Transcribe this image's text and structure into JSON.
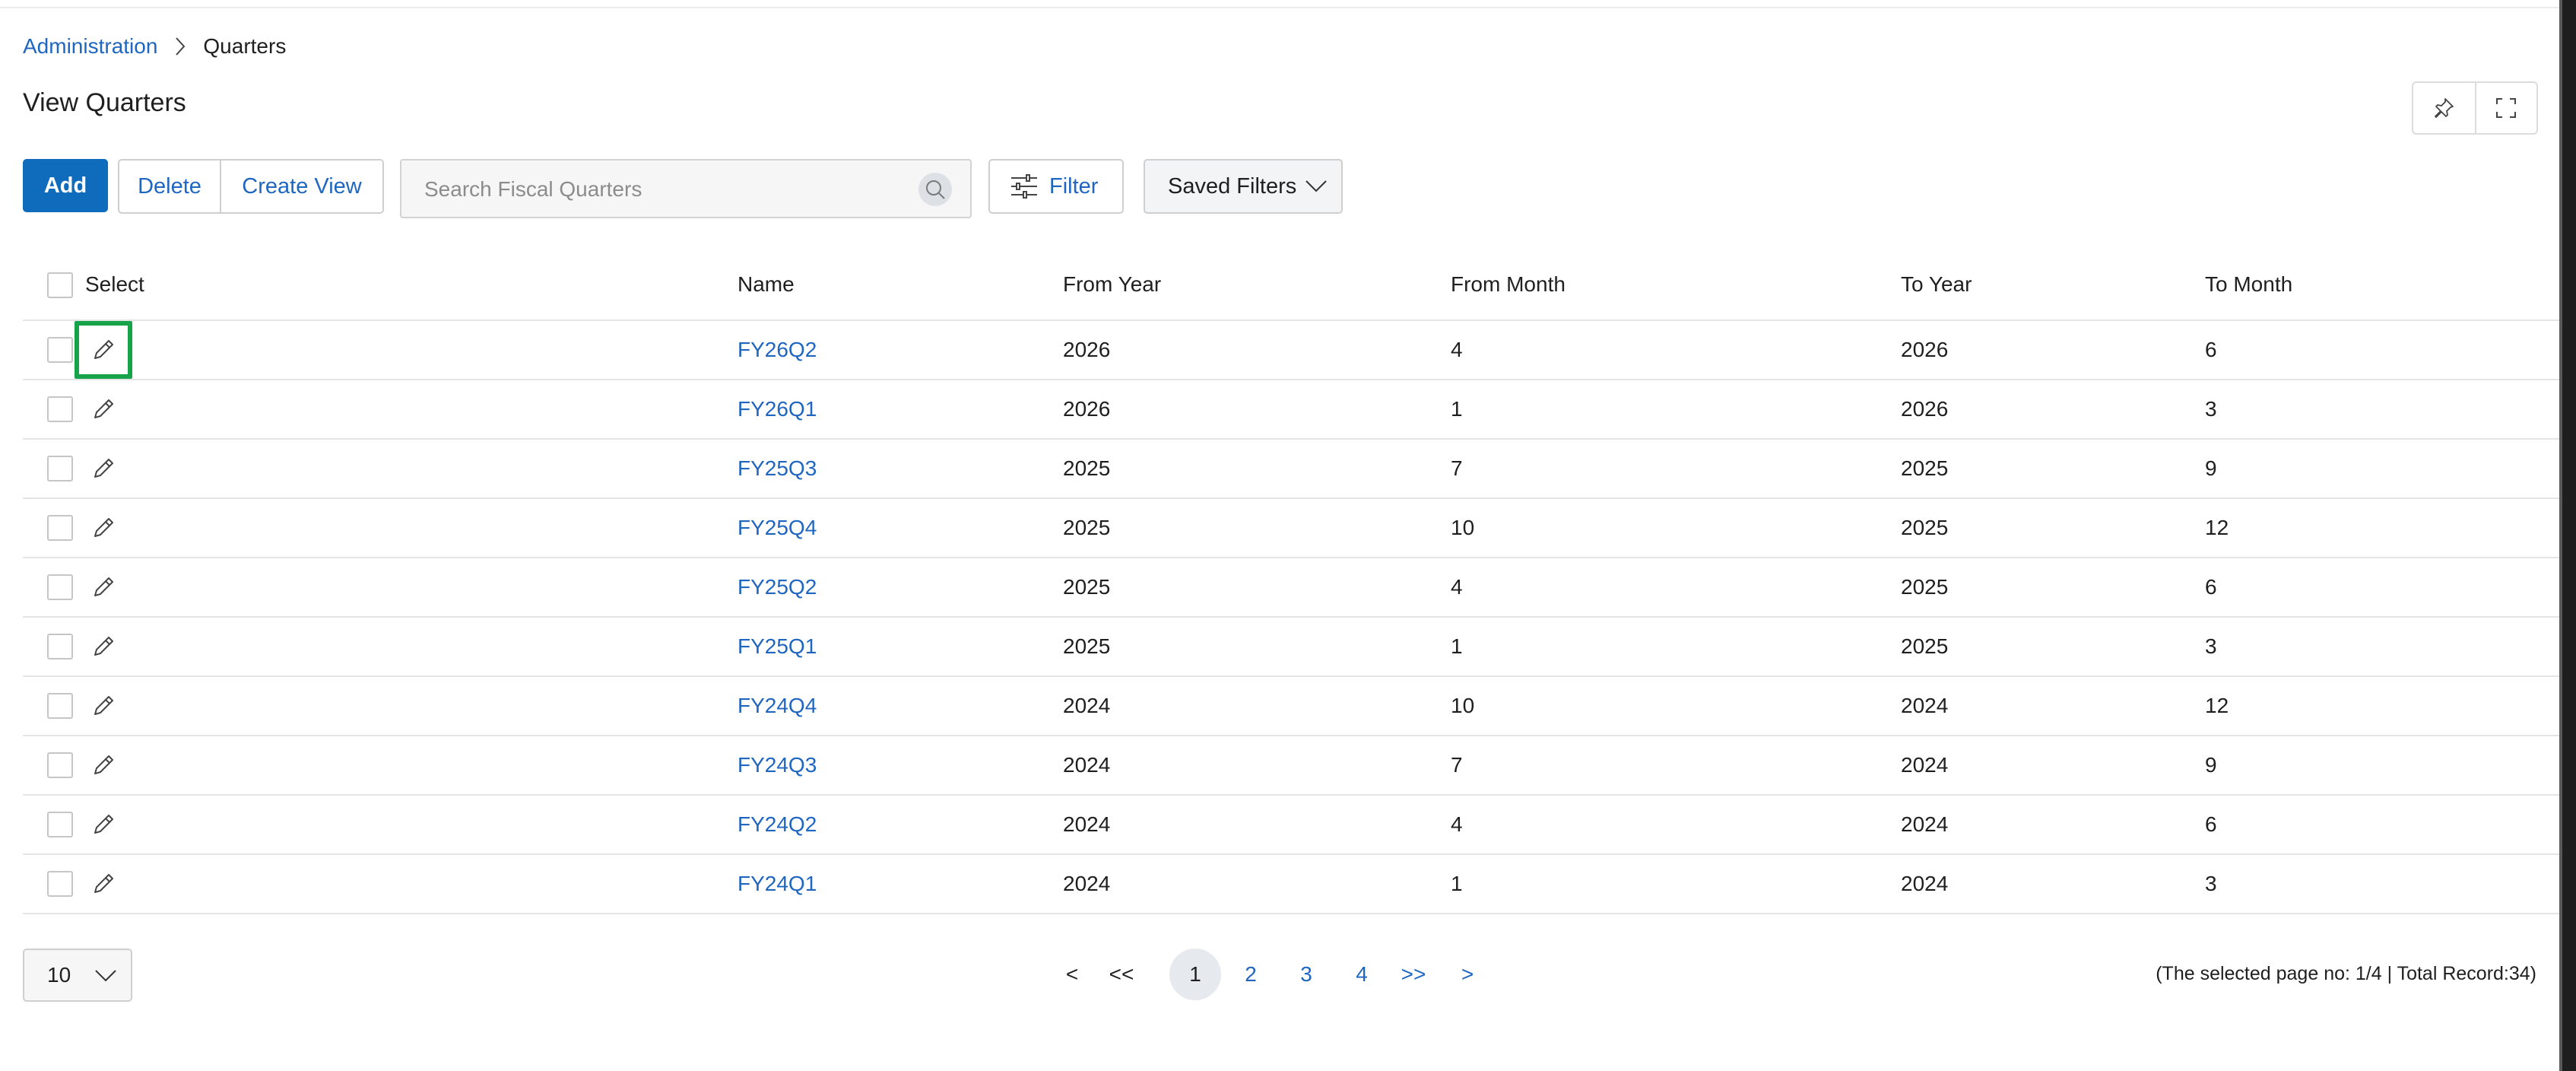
{
  "breadcrumb": {
    "parent": "Administration",
    "current": "Quarters"
  },
  "page": {
    "title": "View Quarters"
  },
  "toolbar": {
    "add_label": "Add",
    "delete_label": "Delete",
    "create_view_label": "Create View",
    "search_placeholder": "Search Fiscal Quarters",
    "search_value": "",
    "filter_label": "Filter",
    "saved_filters_label": "Saved Filters"
  },
  "table": {
    "headers": {
      "select": "Select",
      "name": "Name",
      "from_year": "From Year",
      "from_month": "From Month",
      "to_year": "To Year",
      "to_month": "To Month"
    },
    "rows": [
      {
        "name": "FY26Q2",
        "from_year": "2026",
        "from_month": "4",
        "to_year": "2026",
        "to_month": "6"
      },
      {
        "name": "FY26Q1",
        "from_year": "2026",
        "from_month": "1",
        "to_year": "2026",
        "to_month": "3"
      },
      {
        "name": "FY25Q3",
        "from_year": "2025",
        "from_month": "7",
        "to_year": "2025",
        "to_month": "9"
      },
      {
        "name": "FY25Q4",
        "from_year": "2025",
        "from_month": "10",
        "to_year": "2025",
        "to_month": "12"
      },
      {
        "name": "FY25Q2",
        "from_year": "2025",
        "from_month": "4",
        "to_year": "2025",
        "to_month": "6"
      },
      {
        "name": "FY25Q1",
        "from_year": "2025",
        "from_month": "1",
        "to_year": "2025",
        "to_month": "3"
      },
      {
        "name": "FY24Q4",
        "from_year": "2024",
        "from_month": "10",
        "to_year": "2024",
        "to_month": "12"
      },
      {
        "name": "FY24Q3",
        "from_year": "2024",
        "from_month": "7",
        "to_year": "2024",
        "to_month": "9"
      },
      {
        "name": "FY24Q2",
        "from_year": "2024",
        "from_month": "4",
        "to_year": "2024",
        "to_month": "6"
      },
      {
        "name": "FY24Q1",
        "from_year": "2024",
        "from_month": "1",
        "to_year": "2024",
        "to_month": "3"
      }
    ]
  },
  "pagination": {
    "page_size": "10",
    "prev": "<",
    "first": "<<",
    "pages": [
      "1",
      "2",
      "3",
      "4"
    ],
    "active_page": "1",
    "last": ">>",
    "next": ">",
    "summary": "(The selected page no: 1/4 | Total Record:34)"
  },
  "icons": {
    "breadcrumb_separator": "chevron-right-icon",
    "pin": "pin-icon",
    "fullscreen": "fullscreen-icon",
    "search": "search-icon",
    "filter": "sliders-icon",
    "dropdown": "chevron-down-icon",
    "edit": "pencil-icon"
  },
  "colors": {
    "primary": "#0f6cbd",
    "link": "#1f66c1",
    "focus_outline": "#17a34a"
  }
}
